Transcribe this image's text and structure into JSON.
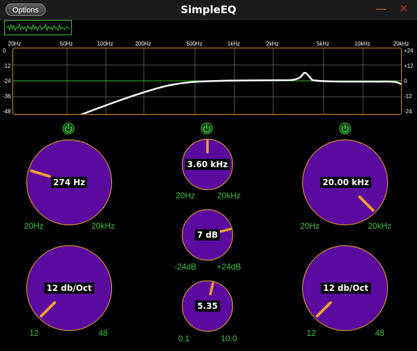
{
  "window": {
    "title": "SimpleEQ",
    "options_label": "Options",
    "minimize_glyph": "—",
    "close_glyph": "✕"
  },
  "response_curve": {
    "freq_labels": [
      "20Hz",
      "50Hz",
      "100Hz",
      "200Hz",
      "500Hz",
      "1kHz",
      "2kHz",
      "5kHz",
      "10kHz",
      "20kHz"
    ],
    "db_labels_left": [
      "0",
      "-12",
      "-24",
      "-36",
      "-48"
    ],
    "db_labels_right": [
      "+24",
      "+12",
      "0",
      "-12",
      "-24"
    ],
    "curve_color": "#ffffff",
    "zero_line_color": "#3ec43e",
    "border_color": "#d49423"
  },
  "low_cut": {
    "freq": {
      "value": "274 Hz",
      "min_label": "20Hz",
      "max_label": "20kHz",
      "position": 0.23
    },
    "slope": {
      "value": "12 db/Oct",
      "min_label": "12",
      "max_label": "48",
      "position": 0.0
    }
  },
  "peak": {
    "freq": {
      "value": "3.60 kHz",
      "min_label": "20Hz",
      "max_label": "20kHz",
      "position": 0.5
    },
    "gain": {
      "value": "7 dB",
      "min_label": "-24dB",
      "max_label": "+24dB",
      "position": 0.78
    },
    "quality": {
      "value": "5.35",
      "min_label": "0.1",
      "max_label": "10.0",
      "position": 0.55
    }
  },
  "high_cut": {
    "freq": {
      "value": "20.00 kHz",
      "min_label": "20Hz",
      "max_label": "20kHz",
      "position": 1.0
    },
    "slope": {
      "value": "12 db/Oct",
      "min_label": "12",
      "max_label": "48",
      "position": 0.0
    }
  },
  "colors": {
    "knob_fill": "#5a0a9e",
    "knob_border": "#d49423",
    "knob_indicator": "#f0a030",
    "power_on": "#3ec43e",
    "range_text": "#3ec43e"
  }
}
